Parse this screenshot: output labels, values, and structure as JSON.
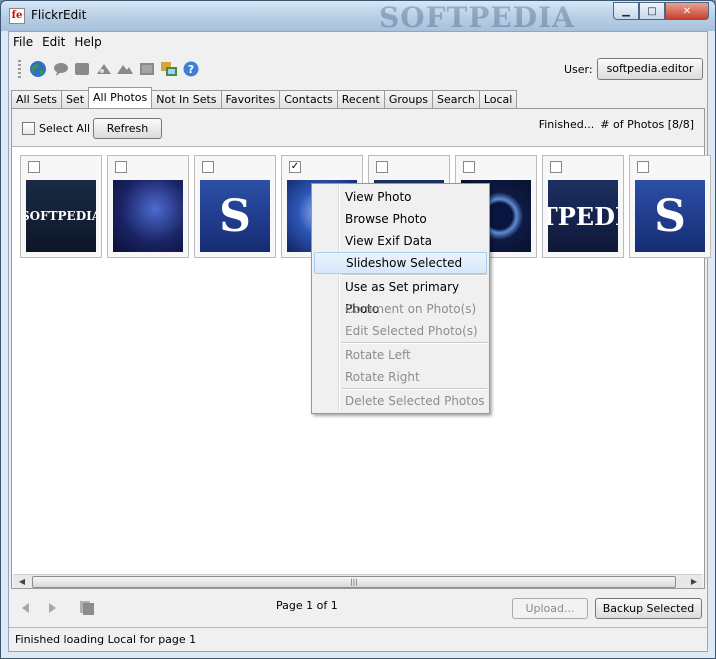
{
  "window": {
    "title": "FlickrEdit",
    "app_icon_text": "fe",
    "watermark": "SOFTPEDIA",
    "controls": {
      "minimize": "▁",
      "maximize": "□",
      "close": "✕"
    }
  },
  "menubar": {
    "items": [
      "File",
      "Edit",
      "Help"
    ]
  },
  "toolbar": {
    "icons": [
      "globe-icon",
      "comment-icon",
      "note-icon",
      "tag-icon",
      "people-icon",
      "frame-icon",
      "gallery-icon",
      "help-icon"
    ],
    "user_label": "User:",
    "user_button": "softpedia.editor"
  },
  "tabs": {
    "items": [
      "All Sets",
      "Set",
      "All Photos",
      "Not In Sets",
      "Favorites",
      "Contacts",
      "Recent",
      "Groups",
      "Search",
      "Local"
    ],
    "active": "All Photos"
  },
  "panel": {
    "select_all_label": "Select All",
    "refresh_label": "Refresh",
    "status": "Finished...",
    "photo_count": "# of Photos [8/8]"
  },
  "thumbnails": [
    {
      "checked": false,
      "style": "softpedia-dark",
      "text": "SOFTPEDIA"
    },
    {
      "checked": false,
      "style": "blue-swirl",
      "text": ""
    },
    {
      "checked": false,
      "style": "blue-s",
      "text": "S"
    },
    {
      "checked": true,
      "style": "blue-glow",
      "text": ""
    },
    {
      "checked": false,
      "style": "dark-blue",
      "text": ""
    },
    {
      "checked": false,
      "style": "blue-ring",
      "text": ""
    },
    {
      "checked": false,
      "style": "softpedia-blue",
      "text": "TPEDI"
    },
    {
      "checked": false,
      "style": "blue-s",
      "text": "S"
    }
  ],
  "scrollbar": {
    "left": "◀",
    "right": "▶",
    "grip": "|||"
  },
  "footer": {
    "page_label": "Page 1 of 1",
    "upload_label": "Upload...",
    "backup_label": "Backup Selected"
  },
  "statusbar": {
    "text": "Finished loading Local for page 1"
  },
  "context_menu": {
    "items": [
      {
        "label": "View Photo",
        "disabled": false
      },
      {
        "label": "Browse Photo",
        "disabled": false
      },
      {
        "label": "View Exif Data",
        "disabled": false
      },
      {
        "label": "Slideshow Selected",
        "disabled": false,
        "hover": true
      },
      {
        "label": "Use as Set primary Photo",
        "disabled": false
      },
      {
        "label": "Comment on Photo(s)",
        "disabled": true
      },
      {
        "label": "Edit Selected Photo(s)",
        "disabled": true
      },
      {
        "label": "Rotate Left",
        "disabled": true
      },
      {
        "label": "Rotate Right",
        "disabled": true
      },
      {
        "label": "Delete Selected Photos",
        "disabled": true
      }
    ]
  },
  "colors": {
    "accent": "#1f3c88",
    "disabled_text": "#8d8d8d",
    "hover": "#d6e8fb"
  }
}
